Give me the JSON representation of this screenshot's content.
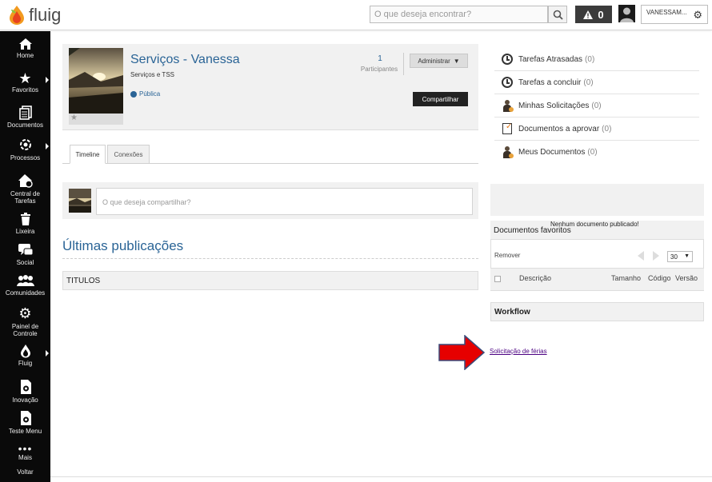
{
  "header": {
    "brand": "fluig",
    "search_placeholder": "O que deseja encontrar?",
    "alert_count": "0",
    "user_name": "VANESSAM..."
  },
  "sidebar": {
    "items": [
      {
        "label": "Home",
        "icon": "home-icon"
      },
      {
        "label": "Favoritos",
        "icon": "star-icon"
      },
      {
        "label": "Documentos",
        "icon": "documents-icon"
      },
      {
        "label": "Processos",
        "icon": "processes-icon"
      },
      {
        "label": "Central de Tarefas",
        "icon": "task-center-icon"
      },
      {
        "label": "Lixeira",
        "icon": "trash-icon"
      },
      {
        "label": "Social",
        "icon": "chat-icon"
      },
      {
        "label": "Comunidades",
        "icon": "communities-icon"
      },
      {
        "label": "Painel de Controle",
        "icon": "gear-icon"
      },
      {
        "label": "Fluig",
        "icon": "fluig-icon"
      },
      {
        "label": "Inovação",
        "icon": "innovation-icon"
      },
      {
        "label": "Teste Menu",
        "icon": "test-menu-icon"
      },
      {
        "label": "Mais",
        "icon": "more-icon"
      },
      {
        "label": "Voltar",
        "icon": "back-icon"
      }
    ]
  },
  "community": {
    "title": "Serviços - Vanessa",
    "subtitle": "Serviços e TSS",
    "visibility": "Pública",
    "participants_count": "1",
    "participants_label": "Participantes",
    "admin_button": "Administrar",
    "share_button": "Compartilhar"
  },
  "tabs": [
    {
      "label": "Timeline",
      "active": true
    },
    {
      "label": "Conexões",
      "active": false
    }
  ],
  "share": {
    "placeholder": "O que deseja compartilhar?"
  },
  "feed": {
    "heading": "Últimas publicações",
    "section": "TITULOS"
  },
  "tasks": [
    {
      "label": "Tarefas Atrasadas",
      "count": "(0)",
      "icon": "clock-icon"
    },
    {
      "label": "Tarefas a concluir",
      "count": "(0)",
      "icon": "clock-icon"
    },
    {
      "label": "Minhas Solicitações",
      "count": "(0)",
      "icon": "person-icon"
    },
    {
      "label": "Documentos a aprovar",
      "count": "(0)",
      "icon": "document-approve-icon"
    },
    {
      "label": "Meus Documentos",
      "count": "(0)",
      "icon": "person-icon"
    }
  ],
  "favorites": {
    "title": "Documentos favoritos",
    "empty_text": "Nenhum documento publicado!",
    "remove_label": "Remover",
    "page_size": "30",
    "columns": [
      "Descrição",
      "Tamanho",
      "Código",
      "Versão"
    ]
  },
  "workflow": {
    "title": "Workflow",
    "link": "Solicitação de férias"
  },
  "colors": {
    "accent": "#2a6496",
    "sidebar": "#0a0a0a",
    "arrow": "#e00000"
  }
}
